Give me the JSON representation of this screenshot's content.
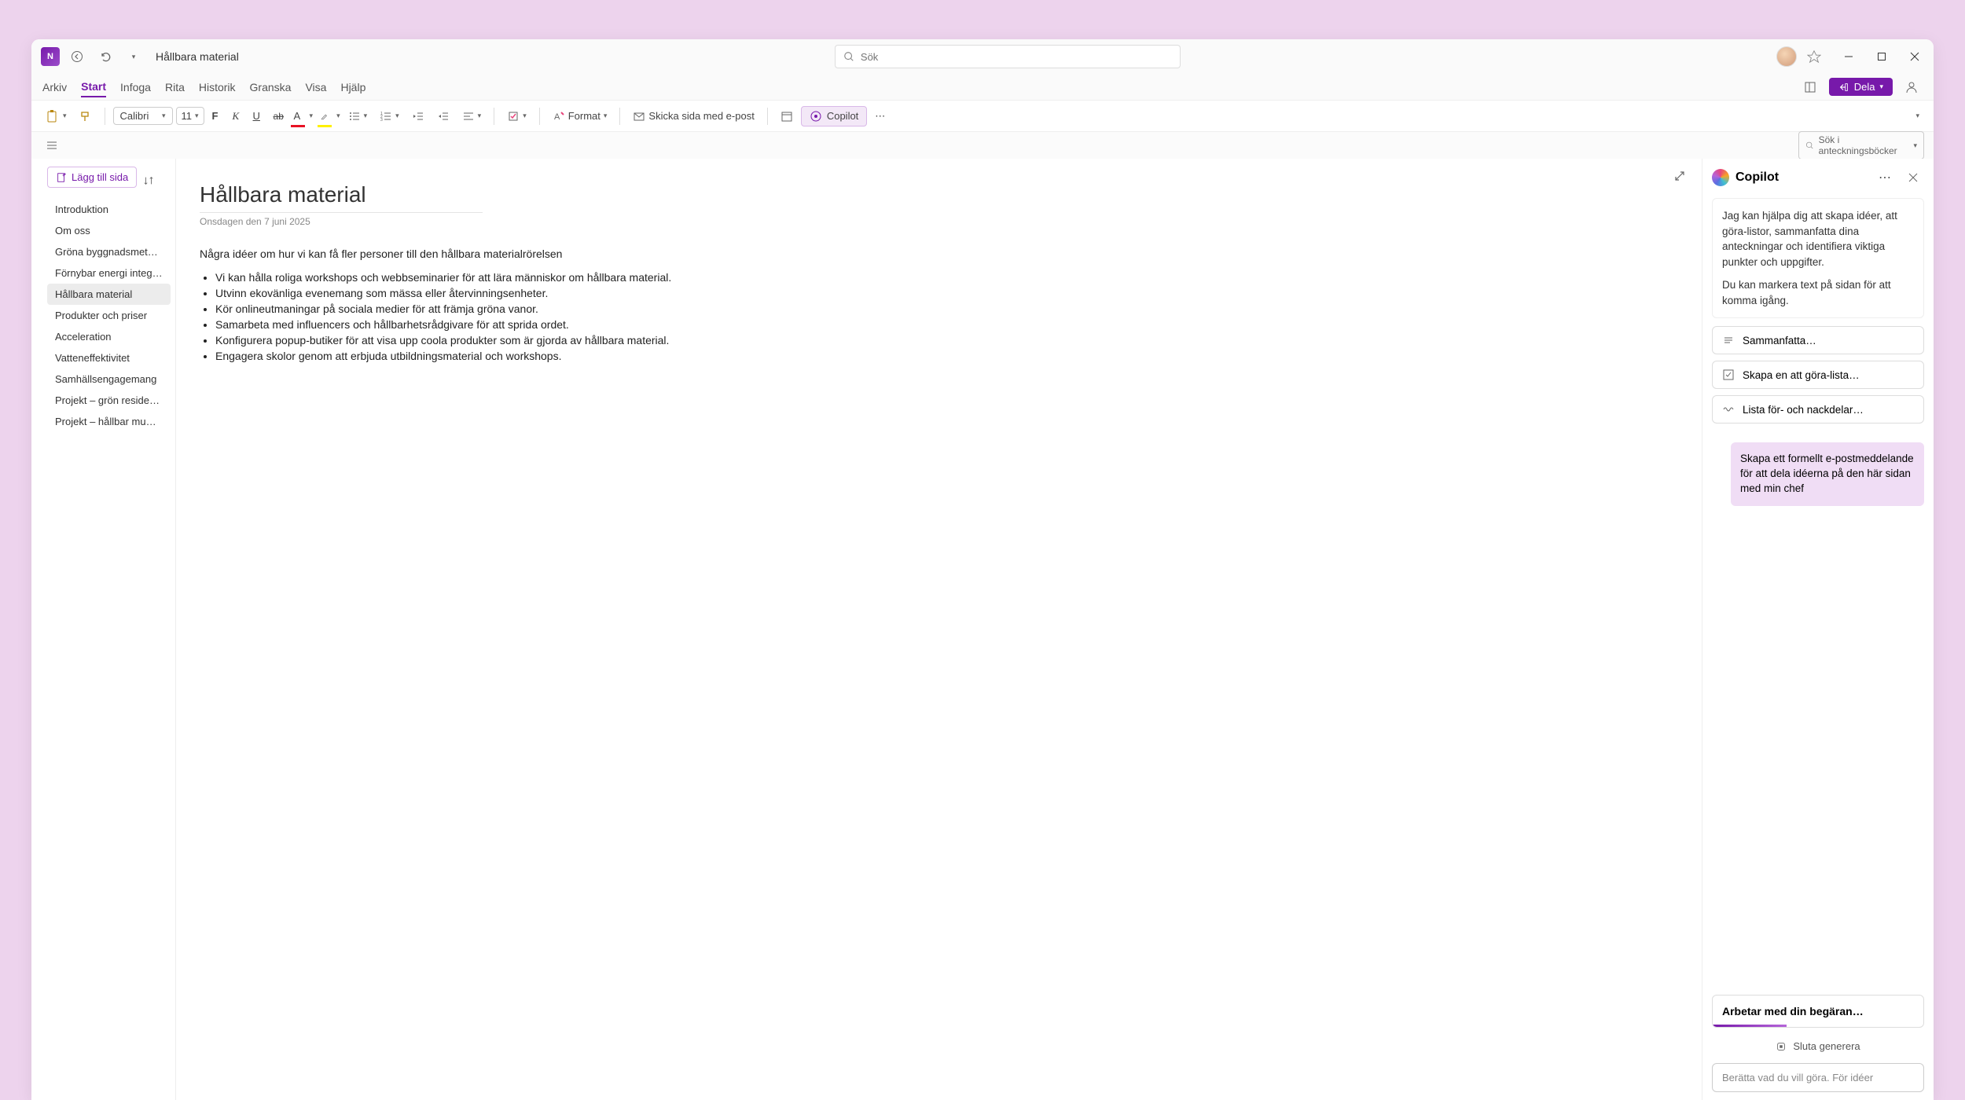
{
  "titlebar": {
    "app_abbr": "N",
    "doc_title": "Hållbara material",
    "search_placeholder": "Sök"
  },
  "ribbon": {
    "tabs": [
      "Arkiv",
      "Start",
      "Infoga",
      "Rita",
      "Historik",
      "Granska",
      "Visa",
      "Hjälp"
    ],
    "active_tab_index": 1,
    "share_label": "Dela"
  },
  "toolbar": {
    "font_name": "Calibri",
    "font_size": "11",
    "format_label": "Format",
    "email_label": "Skicka sida med e-post",
    "copilot_label": "Copilot"
  },
  "notebook_search_placeholder": "Sök i anteckningsböcker",
  "sidebar": {
    "add_page_label": "Lägg till sida",
    "pages": [
      "Introduktion",
      "Om oss",
      "Gröna byggnadsmetoder",
      "Förnybar energi integr…",
      "Hållbara material",
      "Produkter och priser",
      "Acceleration",
      "Vatteneffektivitet",
      "Samhällsengagemang",
      "Projekt – grön resident …",
      "Projekt – hållbar mu…"
    ],
    "active_index": 4
  },
  "editor": {
    "title": "Hållbara material",
    "date": "Onsdagen den 7 juni 2025",
    "intro": "Några idéer om hur vi kan få fler personer till den hållbara materialrörelsen",
    "bullets": [
      "Vi kan hålla roliga workshops och webbseminarier för att lära människor om hållbara material.",
      "Utvinn ekovänliga evenemang som mässa eller återvinningsenheter.",
      "Kör onlineutmaningar på sociala medier för att främja gröna vanor.",
      "Samarbeta med influencers och hållbarhetsrådgivare för att sprida ordet.",
      "Konfigurera popup-butiker för att visa upp coola produkter som är gjorda av hållbara material.",
      "Engagera skolor genom att erbjuda utbildningsmaterial och workshops."
    ]
  },
  "copilot": {
    "title": "Copilot",
    "intro_p1": "Jag kan hjälpa dig att skapa idéer, att göra-listor, sammanfatta dina anteckningar och identifiera viktiga punkter och uppgifter.",
    "intro_p2": "Du kan markera text på sidan för att komma igång.",
    "suggestions": [
      "Sammanfatta…",
      "Skapa en att göra-lista…",
      "Lista för- och nackdelar…"
    ],
    "user_message": "Skapa ett formellt e-postmeddelande för att dela idéerna på den här sidan med min chef",
    "working_label": "Arbetar med din begäran…",
    "stop_label": "Sluta generera",
    "input_placeholder": "Berätta vad du vill göra. För idéer"
  }
}
